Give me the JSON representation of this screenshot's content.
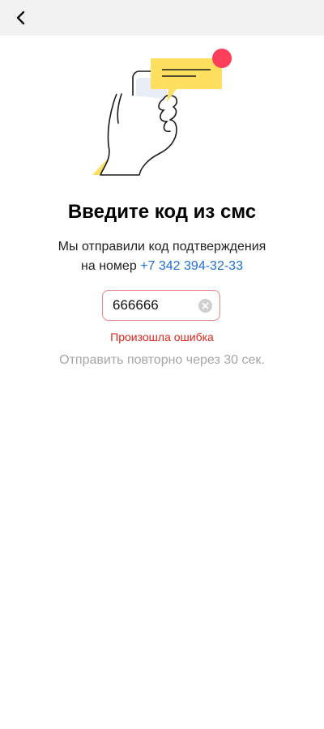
{
  "header": {
    "back_icon": "chevron-left-icon"
  },
  "illustration": {
    "icon": "hand-holding-phone-with-sms-icon",
    "colors": {
      "bubble": "#ffdf60",
      "badge": "#fe3f5c",
      "phone_screen": "#e9edf6",
      "accent_shape": "#ffe066"
    }
  },
  "main": {
    "title": "Введите код из смс",
    "subtitle_line1": "Мы отправили код подтверждения",
    "subtitle_prefix": "на номер",
    "phone_number": "+7 342 394-32-33",
    "code_input": {
      "value": "666666",
      "clear_icon": "clear-circle-icon"
    },
    "error_message": "Произошла ошибка",
    "resend_text": "Отправить повторно через 30 сек."
  },
  "colors": {
    "link": "#1f6fd1",
    "error": "#e0271c",
    "error_border": "#e8878a",
    "muted": "#a6a6a6",
    "topbar": "#f2f2f2"
  }
}
